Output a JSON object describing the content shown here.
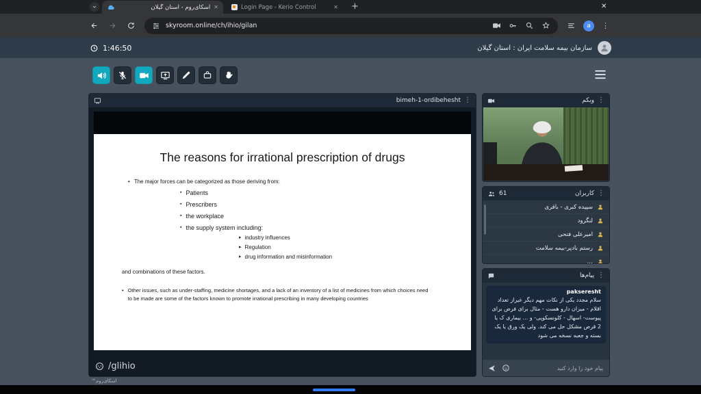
{
  "browser": {
    "tabs": [
      {
        "title": "اسکای‌روم - استان گیلان"
      },
      {
        "title": "Login Page - Kerio Control"
      }
    ],
    "url": "skyroom.online/ch/ihio/gilan",
    "profile_initial": "a"
  },
  "app_header": {
    "timer": "1:46:50",
    "org_title": "سازمان بیمه سلامت ایران : استان گیلان"
  },
  "board": {
    "title": "bimeh-1-ordibehesht",
    "watermark": "/glihio",
    "brand": "اسکای‌روم™",
    "slide": {
      "title": "The reasons for irrational prescription of drugs",
      "intro": "The major forces can be categorized as those deriving from:",
      "level2": [
        "Patients",
        "Prescribers",
        "the workplace",
        "the supply system including:"
      ],
      "level3": [
        "industry influences",
        "Regulation",
        "drug information and misinformation"
      ],
      "after": "and combinations of these factors.",
      "second": "Other issues, such as under-staffing, medicine shortages, and a lack of an inventory of a list of medicines from which choices need to be made are some of the factors known to promote irrational prescribing in many developing countries"
    }
  },
  "webcam": {
    "title": "وبکم"
  },
  "users": {
    "title": "کاربران",
    "count": "61",
    "items": [
      "سپیده کبری - باقری",
      "لنگرود",
      "امیرعلی فتحی",
      "رستم بادپر-بیمه سلامت",
      "…"
    ]
  },
  "messages": {
    "title": "پیام‌ها",
    "sender": "pakseresht",
    "text": "سلام مجدد یکی از نکات مهم دیگر غیراز تعداد اقلام - میزان دارو هست - مثال برای فرض برای پیوست- اسهال - کلونسکوپی- و ... بیماری ک یا 2 قرص مشکل حل می کند. ولی یک ورق یا یک بسته و جعبه نسخه می شود",
    "input_placeholder": "پیام خود را وارد کنید"
  }
}
